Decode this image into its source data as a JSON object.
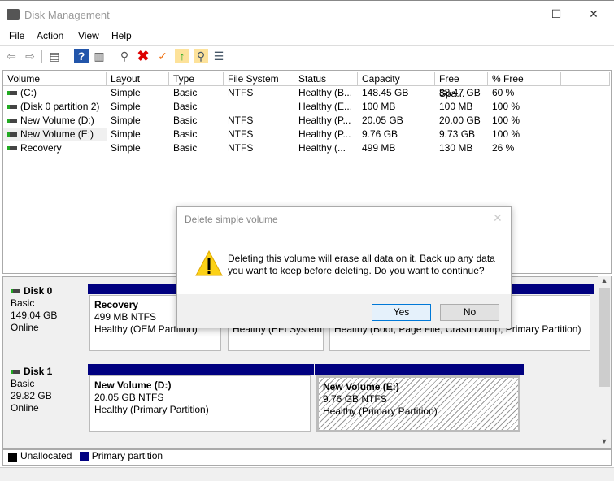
{
  "window": {
    "title": "Disk Management",
    "icon": "disk-management-icon"
  },
  "menu": [
    "File",
    "Action",
    "View",
    "Help"
  ],
  "toolbar": [
    "back-icon",
    "forward-icon",
    "console-tree-icon",
    "help-icon",
    "action-pane-icon",
    "connect-disk-icon",
    "delete-icon",
    "check-icon",
    "export-icon",
    "find-icon",
    "properties-icon"
  ],
  "columns": [
    "Volume",
    "Layout",
    "Type",
    "File System",
    "Status",
    "Capacity",
    "Free Spa...",
    "% Free"
  ],
  "rows": [
    [
      "(C:)",
      "Simple",
      "Basic",
      "NTFS",
      "Healthy (B...",
      "148.45 GB",
      "88.47 GB",
      "60 %"
    ],
    [
      "(Disk 0 partition 2)",
      "Simple",
      "Basic",
      "",
      "Healthy (E...",
      "100 MB",
      "100 MB",
      "100 %"
    ],
    [
      "New Volume (D:)",
      "Simple",
      "Basic",
      "NTFS",
      "Healthy (P...",
      "20.05 GB",
      "20.00 GB",
      "100 %"
    ],
    [
      "New Volume (E:)",
      "Simple",
      "Basic",
      "NTFS",
      "Healthy (P...",
      "9.76 GB",
      "9.73 GB",
      "100 %"
    ],
    [
      "Recovery",
      "Simple",
      "Basic",
      "NTFS",
      "Healthy (...",
      "499 MB",
      "130 MB",
      "26 %"
    ]
  ],
  "disks": [
    {
      "name": "Disk 0",
      "type": "Basic",
      "size": "149.04 GB",
      "state": "Online",
      "partitions": [
        {
          "name": "Recovery",
          "size": "499 MB NTFS",
          "status": "Healthy (OEM Partition)"
        },
        {
          "name": "",
          "size": "",
          "status": "Healthy (EFI System P"
        },
        {
          "name": "",
          "size": "",
          "status": "Healthy (Boot, Page File, Crash Dump, Primary Partition)"
        }
      ]
    },
    {
      "name": "Disk 1",
      "type": "Basic",
      "size": "29.82 GB",
      "state": "Online",
      "partitions": [
        {
          "name": "New Volume  (D:)",
          "size": "20.05 GB NTFS",
          "status": "Healthy (Primary Partition)"
        },
        {
          "name": "New Volume  (E:)",
          "size": "9.76 GB NTFS",
          "status": "Healthy (Primary Partition)"
        }
      ]
    }
  ],
  "legend": [
    {
      "label": "Unallocated",
      "color": "#000000"
    },
    {
      "label": "Primary partition",
      "color": "#000080"
    }
  ],
  "dialog": {
    "title": "Delete simple volume",
    "message": "Deleting this volume will erase all data on it. Back up any data you want to keep before deleting. Do you want to continue?",
    "yes": "Yes",
    "no": "No",
    "icon": "warning-icon"
  }
}
